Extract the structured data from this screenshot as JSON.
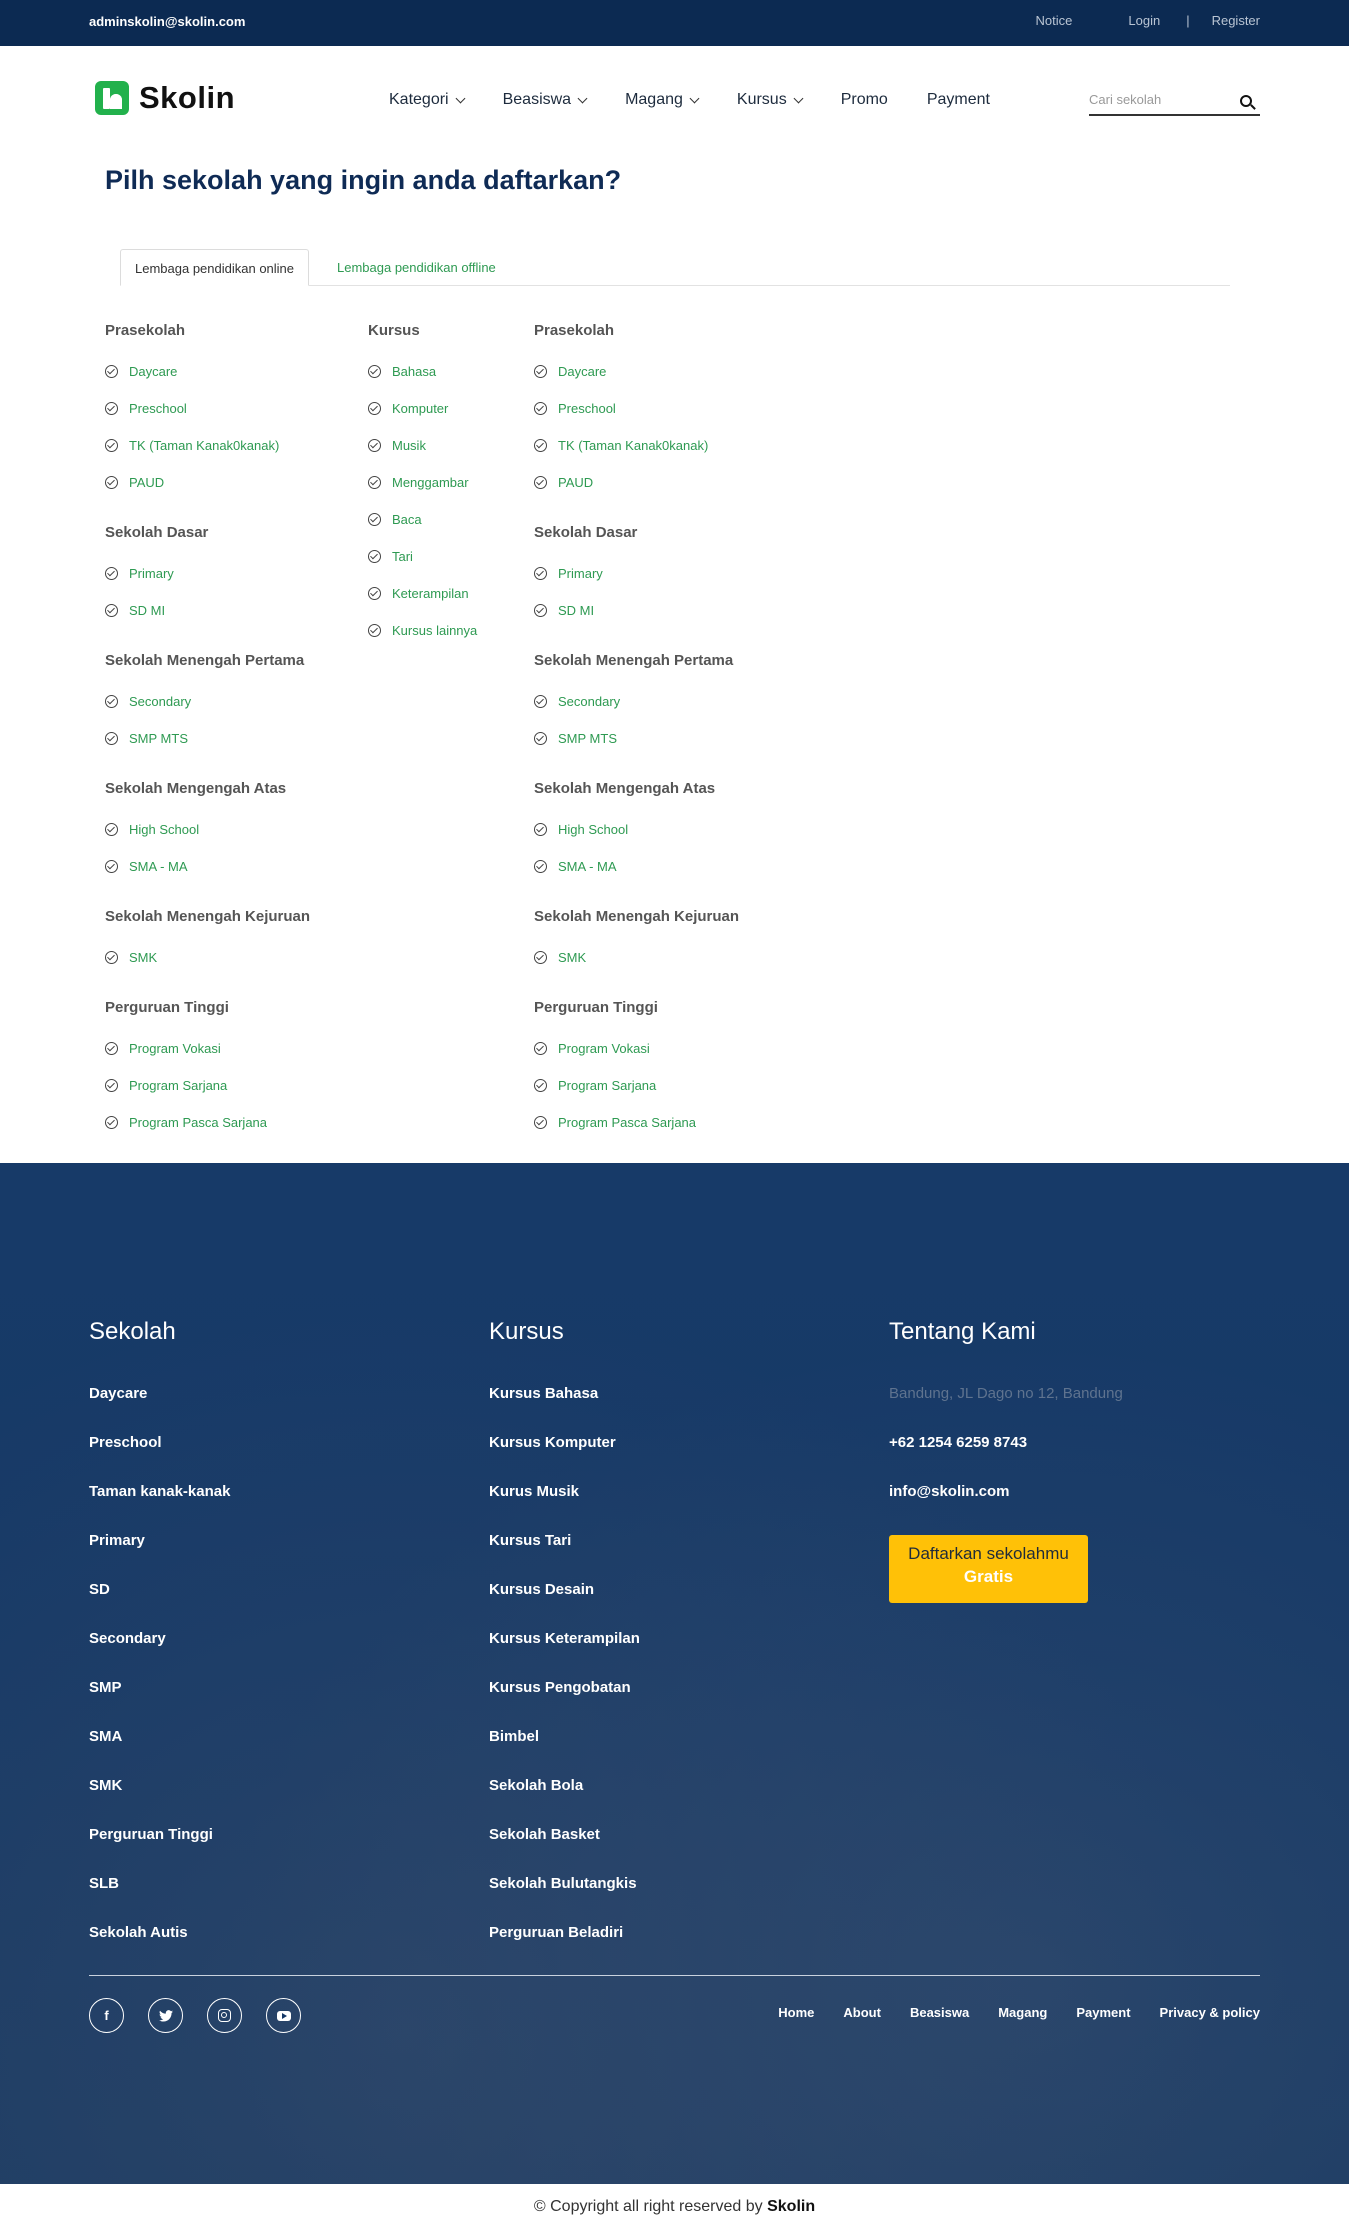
{
  "topbar": {
    "email": "adminskolin@skolin.com",
    "notice": "Notice",
    "login": "Login",
    "separator": "|",
    "register": "Register"
  },
  "header": {
    "logo_text": "Skolin",
    "nav": [
      "Kategori",
      "Beasiswa",
      "Magang",
      "Kursus",
      "Promo",
      "Payment"
    ],
    "search_placeholder": "Cari sekolah"
  },
  "main": {
    "title": "Pilh sekolah yang ingin anda daftarkan?",
    "tabs": [
      "Lembaga pendidikan online",
      "Lembaga pendidikan offline"
    ],
    "col1": {
      "groups": [
        {
          "title": "Prasekolah",
          "items": [
            "Daycare",
            "Preschool",
            "TK (Taman Kanak0kanak)",
            "PAUD"
          ]
        },
        {
          "title": "Sekolah Dasar",
          "items": [
            "Primary",
            "SD MI"
          ]
        },
        {
          "title": "Sekolah Menengah Pertama",
          "items": [
            "Secondary",
            "SMP MTS"
          ]
        },
        {
          "title": "Sekolah Mengengah Atas",
          "items": [
            "High School",
            "SMA - MA"
          ]
        },
        {
          "title": "Sekolah Menengah Kejuruan",
          "items": [
            "SMK"
          ]
        },
        {
          "title": "Perguruan Tinggi",
          "items": [
            "Program Vokasi",
            "Program Sarjana",
            "Program Pasca Sarjana"
          ]
        }
      ]
    },
    "col2": {
      "title": "Kursus",
      "items": [
        "Bahasa",
        "Komputer",
        "Musik",
        "Menggambar",
        "Baca",
        "Tari",
        "Keterampilan",
        "Kursus lainnya"
      ]
    },
    "col3": {
      "groups": [
        {
          "title": "Prasekolah",
          "items": [
            "Daycare",
            "Preschool",
            "TK (Taman Kanak0kanak)",
            "PAUD"
          ]
        },
        {
          "title": "Sekolah Dasar",
          "items": [
            "Primary",
            "SD MI"
          ]
        },
        {
          "title": "Sekolah Menengah Pertama",
          "items": [
            "Secondary",
            "SMP MTS"
          ]
        },
        {
          "title": "Sekolah Mengengah Atas",
          "items": [
            "High School",
            "SMA - MA"
          ]
        },
        {
          "title": "Sekolah Menengah Kejuruan",
          "items": [
            "SMK"
          ]
        },
        {
          "title": "Perguruan Tinggi",
          "items": [
            "Program Vokasi",
            "Program Sarjana",
            "Program Pasca Sarjana"
          ]
        }
      ]
    }
  },
  "footer": {
    "sekolah": {
      "title": "Sekolah",
      "links": [
        "Daycare",
        "Preschool",
        "Taman kanak-kanak",
        "Primary",
        "SD",
        "Secondary",
        "SMP",
        "SMA",
        "SMK",
        "Perguruan Tinggi",
        "SLB",
        "Sekolah Autis"
      ]
    },
    "kursus": {
      "title": "Kursus",
      "links": [
        "Kursus Bahasa",
        "Kursus Komputer",
        "Kurus Musik",
        "Kursus Tari",
        "Kursus Desain",
        "Kursus Keterampilan",
        "Kursus Pengobatan",
        "Bimbel",
        "Sekolah Bola",
        "Sekolah Basket",
        "Sekolah Bulutangkis",
        "Perguruan Beladiri"
      ]
    },
    "tentang": {
      "title": "Tentang Kami",
      "address": "Bandung, JL Dago no 12, Bandung",
      "phone": "+62 1254 6259 8743",
      "email": "info@skolin.com",
      "cta_line1": "Daftarkan sekolahmu",
      "cta_line2": "Gratis"
    },
    "social_icons": [
      "facebook-icon",
      "twitter-icon",
      "instagram-icon",
      "youtube-icon"
    ],
    "bottom_nav": [
      "Home",
      "About",
      "Beasiswa",
      "Magang",
      "Payment",
      "Privacy & policy"
    ]
  },
  "copyright": {
    "text": "© Copyright all right reserved by",
    "brand": "Skolin"
  },
  "colors": {
    "navy": "#0c2a52",
    "green": "#2e9a52",
    "brand_green": "#22b14c",
    "cta_yellow": "#ffc107"
  }
}
